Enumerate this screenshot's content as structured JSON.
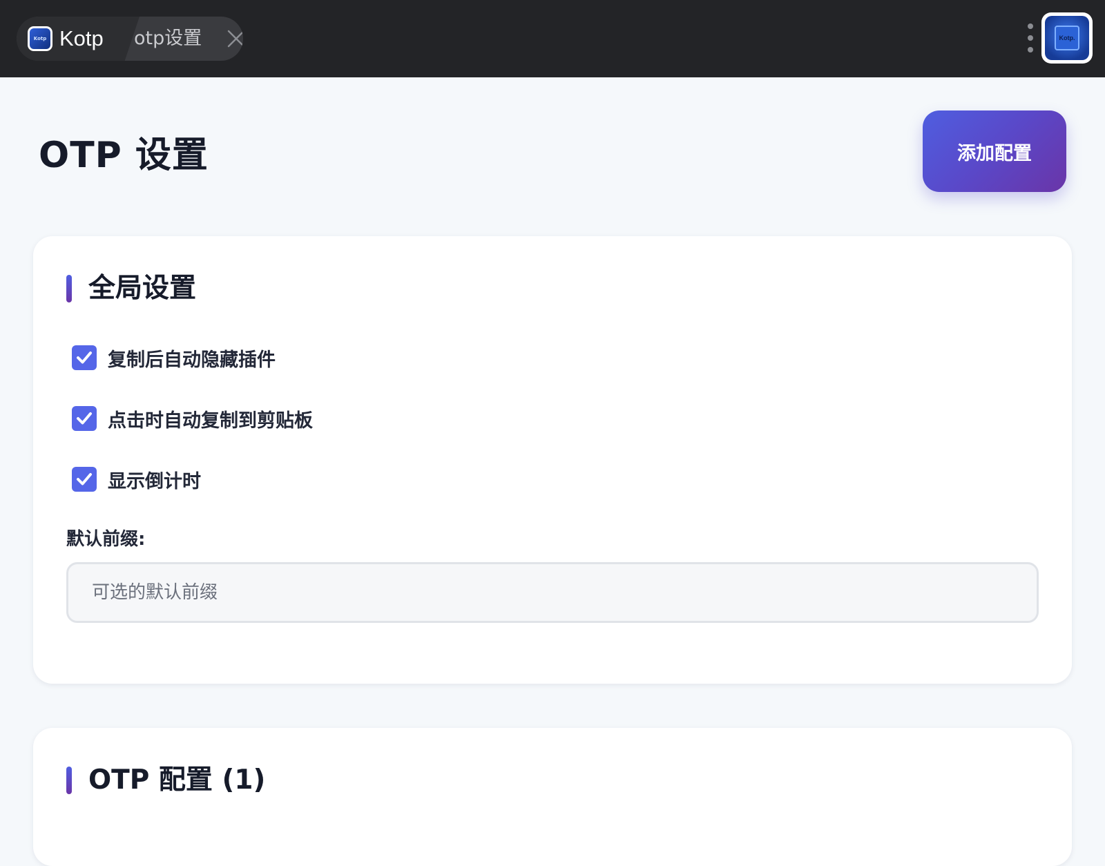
{
  "topbar": {
    "app_name": "Kotp",
    "tab_label": "otp设置",
    "avatar_text": "Kotp.",
    "app_icon_text": "Kotp"
  },
  "header": {
    "title": "OTP 设置",
    "add_button_label": "添加配置"
  },
  "global_settings": {
    "title": "全局设置",
    "options": [
      {
        "label": "复制后自动隐藏插件",
        "checked": true
      },
      {
        "label": "点击时自动复制到剪贴板",
        "checked": true
      },
      {
        "label": "显示倒计时",
        "checked": true
      }
    ],
    "prefix_label": "默认前缀:",
    "prefix_value": "",
    "prefix_placeholder": "可选的默认前缀"
  },
  "otp_configs": {
    "title": "OTP 配置 (1)"
  },
  "colors": {
    "accent": "#5566e8",
    "accent_end": "#6a35a8",
    "topbar_bg": "#232427",
    "page_bg": "#f5f8fb"
  }
}
